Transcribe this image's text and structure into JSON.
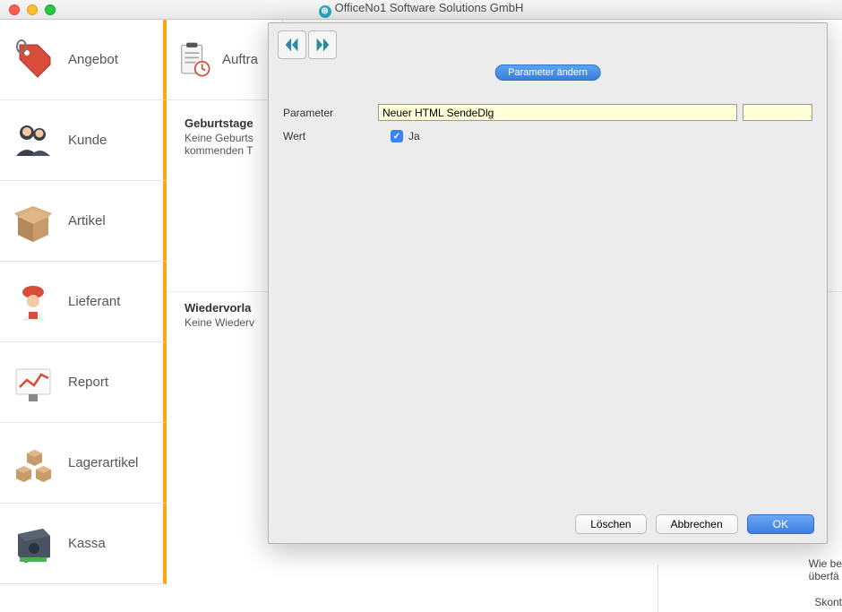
{
  "window": {
    "title": "OfficeNo1 Software Solutions GmbH"
  },
  "sidebar": {
    "items": [
      {
        "label": "Angebot"
      },
      {
        "label": "Kunde"
      },
      {
        "label": "Artikel"
      },
      {
        "label": "Lieferant"
      },
      {
        "label": "Report"
      },
      {
        "label": "Lagerartikel"
      },
      {
        "label": "Kassa"
      }
    ]
  },
  "col2": {
    "label": "Auftra"
  },
  "sections": {
    "birthdays": {
      "title": "Geburtstage",
      "body": "Keine Geburts\nkommenden T"
    },
    "followup": {
      "title": "Wiedervorla",
      "body": "Keine Wiederv"
    }
  },
  "dialog": {
    "title": "Parameter ändern",
    "labels": {
      "parameter": "Parameter",
      "value": "Wert"
    },
    "parameter_value": "Neuer HTML SendeDlg",
    "parameter_value2": "",
    "checkbox_label": "Ja",
    "checkbox_checked": true,
    "buttons": {
      "delete": "Löschen",
      "cancel": "Abbrechen",
      "ok": "OK"
    }
  },
  "peek": {
    "line1": "Wie be",
    "line2": "überfä",
    "bottom": "Skont"
  }
}
